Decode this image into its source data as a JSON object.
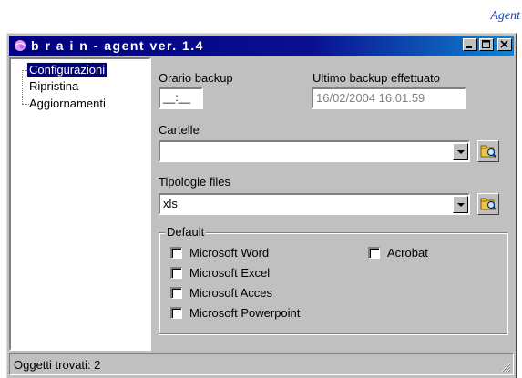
{
  "corner_label": "Agent",
  "window": {
    "title": "b r a i n - agent ver. 1.4",
    "minimize_symbol": "_",
    "maximize_symbol": "□",
    "close_symbol": "✕"
  },
  "tree": {
    "items": [
      {
        "label": "Configurazioni",
        "selected": true
      },
      {
        "label": "Ripristina",
        "selected": false
      },
      {
        "label": "Aggiornamenti",
        "selected": false
      }
    ]
  },
  "form": {
    "backup_time_label": "Orario backup",
    "backup_time_value": "__:__",
    "last_backup_label": "Ultimo backup effettuato",
    "last_backup_value": "16/02/2004 16.01.59",
    "folders_label": "Cartelle",
    "folders_value": "",
    "file_types_label": "Tipologie files",
    "file_types_value": "xls"
  },
  "default_group": {
    "legend": "Default",
    "options": [
      {
        "label": "Microsoft Word",
        "checked": false
      },
      {
        "label": "Microsoft Excel",
        "checked": false
      },
      {
        "label": "Microsoft Acces",
        "checked": false
      },
      {
        "label": "Microsoft Powerpoint",
        "checked": false
      },
      {
        "label": "Acrobat",
        "checked": false
      }
    ]
  },
  "status": {
    "text": "Oggetti trovati: 2"
  },
  "colors": {
    "titlebar_start": "#000080",
    "titlebar_end": "#1084d0",
    "face": "#c0c0c0",
    "selection": "#000080",
    "corner_label": "#1a3fb0"
  }
}
